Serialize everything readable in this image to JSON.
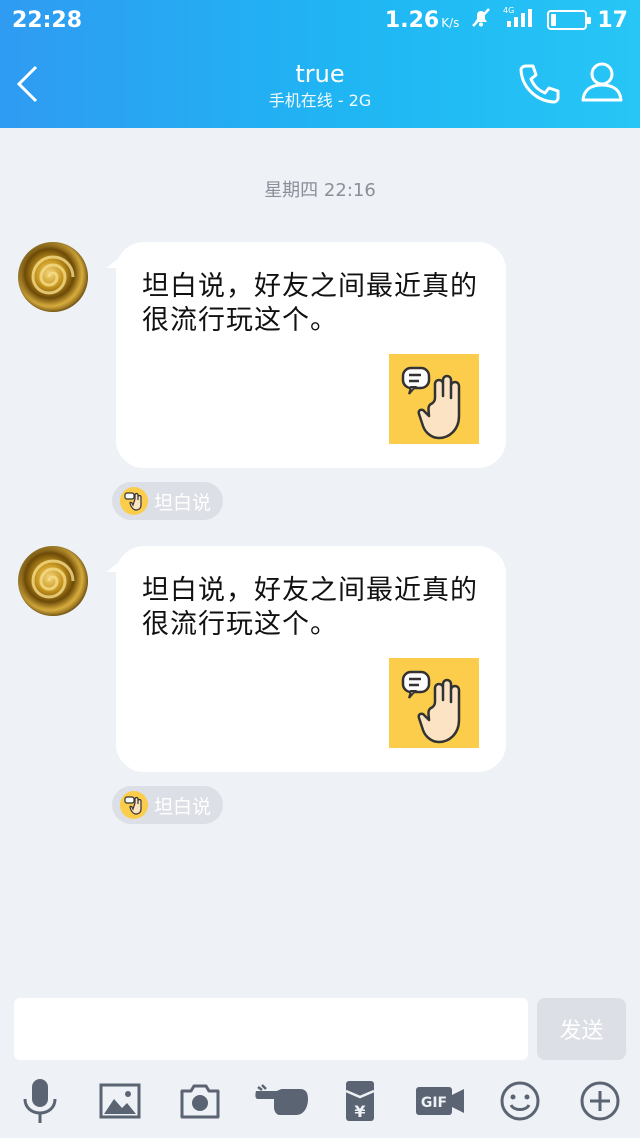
{
  "status": {
    "time": "22:28",
    "speed": "1.26",
    "speed_unit": "K/s",
    "network": "4G",
    "battery": "17",
    "battery_level_percent": 17
  },
  "header": {
    "title": "true",
    "subtitle": "手机在线 - 2G"
  },
  "chat": {
    "time_divider": "星期四 22:16",
    "messages": [
      {
        "text": "坦白说，好友之间最近真的很流行玩这个。",
        "tag": "坦白说"
      },
      {
        "text": "坦白说，好友之间最近真的很流行玩这个。",
        "tag": "坦白说"
      }
    ]
  },
  "input": {
    "placeholder": "",
    "send_label": "发送"
  },
  "toolbar": {
    "gif_label": "GIF",
    "yen_label": "¥"
  },
  "colors": {
    "header_start": "#2f9bf2",
    "header_end": "#27c6f6",
    "background": "#eef1f6",
    "bubble": "#ffffff",
    "sticker": "#fbcd4a",
    "icon_gray": "#5b6472"
  }
}
